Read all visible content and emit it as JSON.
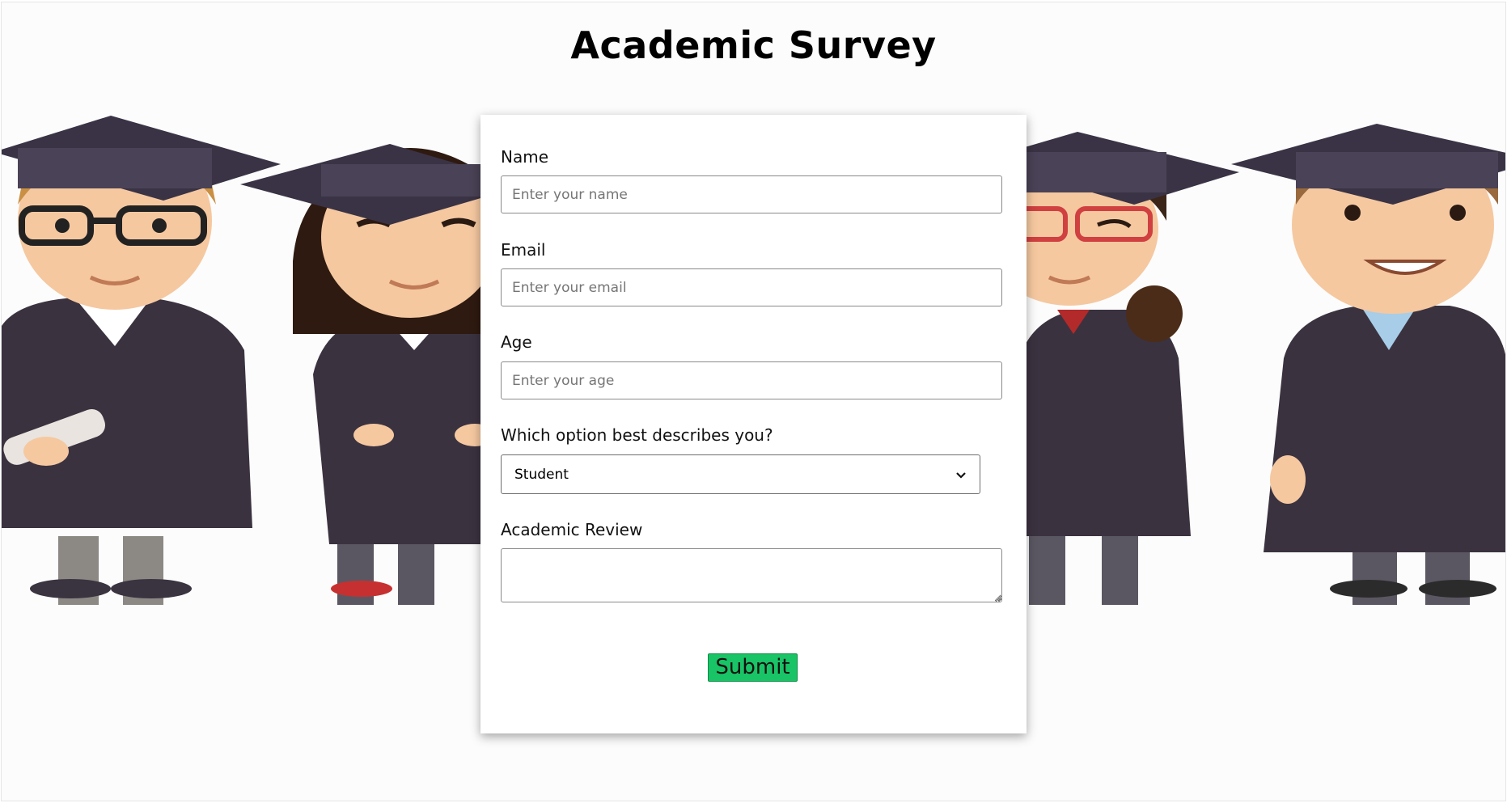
{
  "page": {
    "title": "Academic Survey"
  },
  "form": {
    "name": {
      "label": "Name",
      "placeholder": "Enter your name",
      "value": ""
    },
    "email": {
      "label": "Email",
      "placeholder": "Enter your email",
      "value": ""
    },
    "age": {
      "label": "Age",
      "placeholder": "Enter your age",
      "value": ""
    },
    "role": {
      "label": "Which option best describes you?",
      "selected": "Student"
    },
    "review": {
      "label": "Academic Review",
      "value": ""
    },
    "submit_label": "Submit"
  },
  "colors": {
    "submit_bg": "#19c466",
    "gown": "#3b3240",
    "cap": "#3a3345"
  },
  "icons": {
    "select_arrow": "chevron-down-icon"
  }
}
